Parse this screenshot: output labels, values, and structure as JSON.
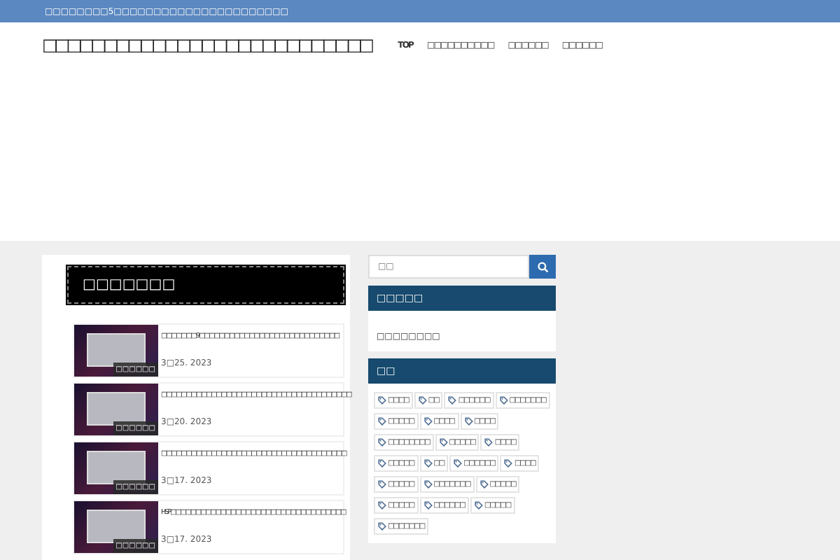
{
  "top_bar": {
    "text": "□□□□□□□□5□□□□□□□□□□□□□□□□□□□□□□"
  },
  "header": {
    "site_title": "□□□□□□□□□□□□□□□□□□□□□□□□□□□",
    "nav": [
      "TOP",
      "□□□□□□□□□□",
      "□□□□□□",
      "□□□□□□"
    ]
  },
  "main": {
    "heading": "□□□□□□□",
    "posts": [
      {
        "title": "□□□□□□□9□□□□□□□□□□□□□□□□□□□□□□□□□□□□",
        "date": "3□25. 2023",
        "category": "□□□□□□"
      },
      {
        "title": "□□□□□□□□□□□□□□□□□□□□□□□□□□□□□□□□□□□□□□",
        "date": "3□20. 2023",
        "category": "□□□□□□"
      },
      {
        "title": "□□□□□□□□□□□□□□□□□□□□□□□□□□□□□□□□□□□□□",
        "date": "3□17. 2023",
        "category": "□□□□□□"
      },
      {
        "title": "HSP□□□□□□□□□□□□□□□□□□□□□□□□□□□□□□□□□□□",
        "date": "3□17. 2023",
        "category": "□□□□□□"
      }
    ]
  },
  "sidebar": {
    "search": {
      "placeholder": "□□"
    },
    "category_widget": {
      "title": "□□□□□",
      "items": [
        "□□□□□□□□"
      ]
    },
    "tag_widget": {
      "title": "□□",
      "tags": [
        "□□□□",
        "□□",
        "□□□□□□",
        "□□□□□□□",
        "□□□□□",
        "□□□□",
        "□□□□",
        "□□□□□□□□",
        "□□□□□",
        "□□□□",
        "□□□□□",
        "□□",
        "□□□□□□",
        "□□□□",
        "□□□□□",
        "□□□□□□□",
        "□□□□□",
        "□□□□□",
        "□□□□□□",
        "□□□□□",
        "□□□□□□□"
      ]
    }
  }
}
